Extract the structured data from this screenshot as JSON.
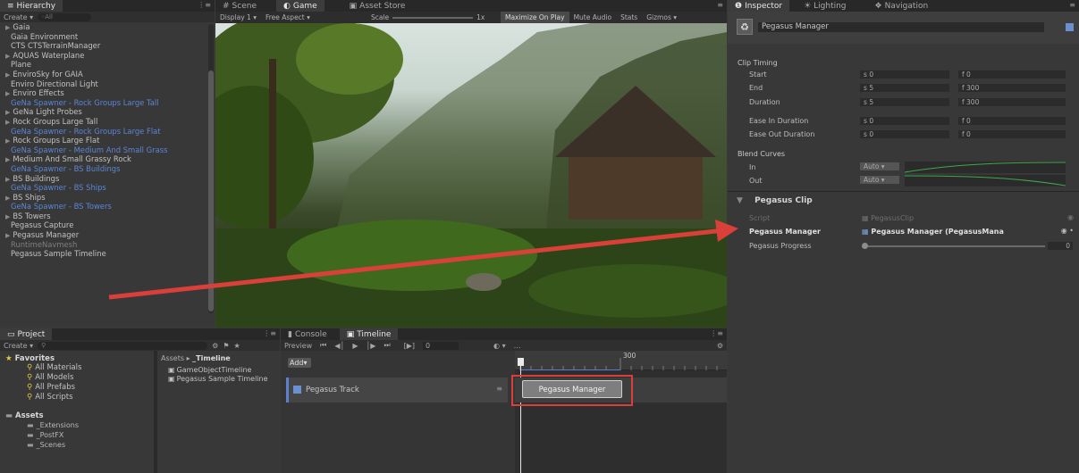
{
  "hierarchy": {
    "tab": "Hierarchy",
    "create_label": "Create ▾",
    "search_placeholder": "◦All",
    "items": [
      {
        "label": "Gaia",
        "arrow": true,
        "style": "normal"
      },
      {
        "label": "Gaia Environment",
        "arrow": false,
        "style": "normal"
      },
      {
        "label": "CTS CTSTerrainManager",
        "arrow": false,
        "style": "normal"
      },
      {
        "label": "AQUAS Waterplane",
        "arrow": true,
        "style": "normal"
      },
      {
        "label": "Plane",
        "arrow": false,
        "style": "normal"
      },
      {
        "label": "EnviroSky for GAIA",
        "arrow": true,
        "style": "normal"
      },
      {
        "label": "Enviro Directional Light",
        "arrow": false,
        "style": "normal"
      },
      {
        "label": "Enviro Effects",
        "arrow": true,
        "style": "normal"
      },
      {
        "label": "GeNa Spawner - Rock Groups Large Tall",
        "arrow": false,
        "style": "blue"
      },
      {
        "label": "GeNa Light Probes",
        "arrow": true,
        "style": "normal"
      },
      {
        "label": "Rock Groups Large Tall",
        "arrow": true,
        "style": "normal"
      },
      {
        "label": "GeNa Spawner - Rock Groups Large Flat",
        "arrow": false,
        "style": "blue"
      },
      {
        "label": "Rock Groups Large Flat",
        "arrow": true,
        "style": "normal"
      },
      {
        "label": "GeNa Spawner - Medium And Small Grass",
        "arrow": false,
        "style": "blue"
      },
      {
        "label": "Medium And Small Grassy Rock",
        "arrow": true,
        "style": "normal"
      },
      {
        "label": "GeNa Spawner - BS Buildings",
        "arrow": false,
        "style": "blue"
      },
      {
        "label": "BS Buildings",
        "arrow": true,
        "style": "normal"
      },
      {
        "label": "GeNa Spawner - BS Ships",
        "arrow": false,
        "style": "blue"
      },
      {
        "label": "BS Ships",
        "arrow": true,
        "style": "normal"
      },
      {
        "label": "GeNa Spawner - BS Towers",
        "arrow": false,
        "style": "blue"
      },
      {
        "label": "BS Towers",
        "arrow": true,
        "style": "normal"
      },
      {
        "label": "Pegasus Capture",
        "arrow": false,
        "style": "normal"
      },
      {
        "label": "Pegasus Manager",
        "arrow": true,
        "style": "normal"
      },
      {
        "label": "RuntimeNavmesh",
        "arrow": false,
        "style": "grey"
      },
      {
        "label": "Pegasus Sample Timeline",
        "arrow": false,
        "style": "normal"
      }
    ]
  },
  "game": {
    "tabs": [
      "Scene",
      "Game",
      "Asset Store"
    ],
    "toolbar": [
      "Display 1",
      "Free Aspect",
      "Scale",
      "1x",
      "Maximize On Play",
      "Mute Audio",
      "Stats",
      "Gizmos"
    ]
  },
  "inspector": {
    "tabs": [
      "Inspector",
      "Lighting",
      "Navigation"
    ],
    "object_name": "Pegasus Manager",
    "section_clip_timing": "Clip Timing",
    "rows": [
      {
        "label": "Start",
        "s": "0",
        "f": "0"
      },
      {
        "label": "End",
        "s": "5",
        "f": "300"
      },
      {
        "label": "Duration",
        "s": "5",
        "f": "300"
      },
      {
        "label": "Ease In Duration",
        "s": "0",
        "f": "0"
      },
      {
        "label": "Ease Out Duration",
        "s": "0",
        "f": "0"
      }
    ],
    "s_prefix": "s",
    "f_prefix": "f",
    "section_blend": "Blend Curves",
    "blend_in": "In",
    "blend_out": "Out",
    "blend_value": "Auto",
    "component_title": "Pegasus Clip",
    "script_label": "Script",
    "script_value": "PegasusClip",
    "manager_label": "Pegasus Manager",
    "manager_value": "Pegasus Manager (PegasusMana",
    "progress_label": "Pegasus Progress",
    "progress_value": "0",
    "progress_fraction": 0
  },
  "project": {
    "tab": "Project",
    "create_label": "Create ▾",
    "favorites_title": "Favorites",
    "favorites": [
      "All Materials",
      "All Models",
      "All Prefabs",
      "All Scripts"
    ],
    "assets_title": "Assets",
    "assets": [
      "_Extensions",
      "_PostFX",
      "_Scenes"
    ],
    "breadcrumb_root": "Assets",
    "breadcrumb_sep": "▸",
    "breadcrumb_current": "_Timeline",
    "files": [
      "GameObjectTimeline",
      "Pegasus Sample Timeline"
    ]
  },
  "timeline": {
    "tabs": [
      "Console",
      "Timeline"
    ],
    "preview_label": "Preview",
    "frame_value": "0",
    "add_label": "Add",
    "track_name": "Pegasus Track",
    "clip_name": "Pegasus Manager",
    "ruler_label": "300"
  },
  "colors": {
    "highlight": "#d9403a",
    "blue_item": "#5b86d6"
  }
}
